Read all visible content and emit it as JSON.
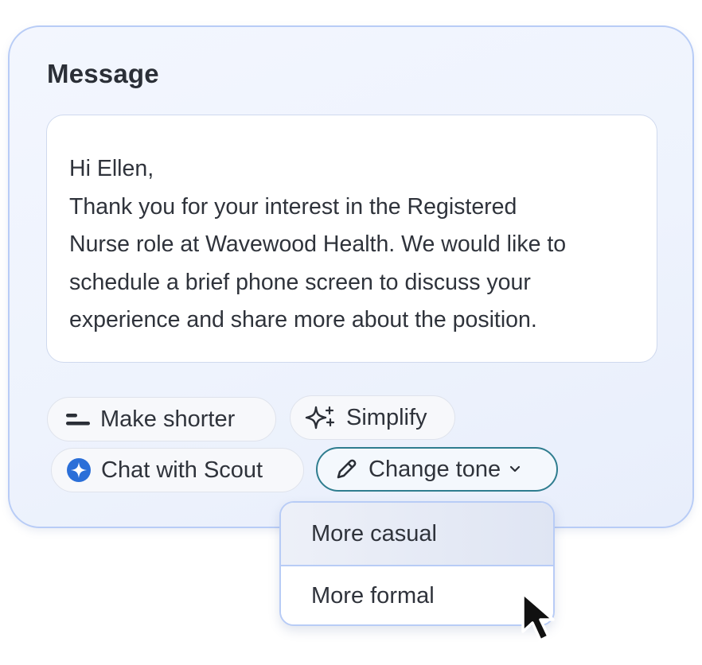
{
  "card": {
    "title": "Message"
  },
  "message": {
    "greeting": "Hi Ellen,",
    "line1": "Thank you for your interest in the Registered",
    "line2": "Nurse role at Wavewood Health. We would like to",
    "line3": "schedule a brief phone screen to discuss your",
    "line4": "experience and share more about the position."
  },
  "actions": {
    "make_shorter": "Make shorter",
    "simplify": "Simplify",
    "chat_with_scout": "Chat with Scout",
    "change_tone": "Change tone"
  },
  "tone_menu": {
    "items": [
      {
        "label": "More casual",
        "state": "hovered"
      },
      {
        "label": "More formal"
      }
    ]
  },
  "icons": {
    "make_shorter": "short-lines-icon",
    "simplify": "sparkle-icon",
    "chat_with_scout": "scout-star-icon",
    "change_tone": "pencil-icon",
    "dropdown": "chevron-down-icon",
    "pointer": "mouse-cursor-icon"
  },
  "colors": {
    "card_border": "#b8ccf6",
    "active_pill_border": "#2f7d8f",
    "scout_icon_blue": "#2b6fd8",
    "hover_item_bg": "#dfe5f3"
  }
}
